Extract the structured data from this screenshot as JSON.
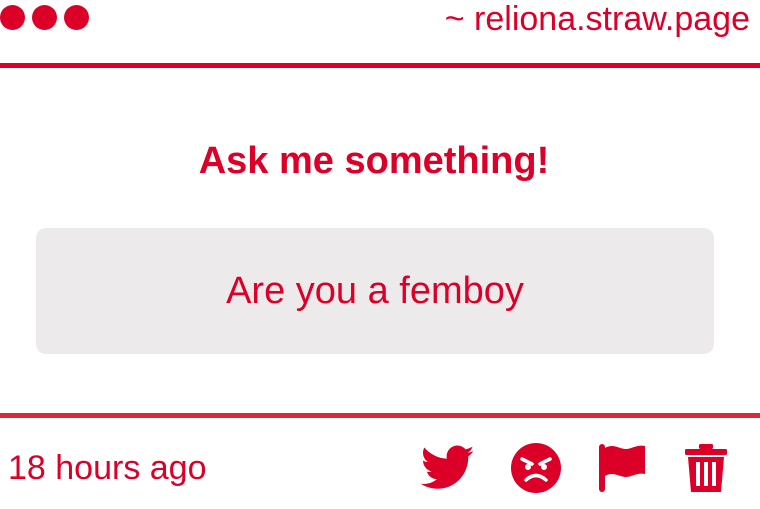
{
  "window": {
    "domain": "~ reliona.straw.page",
    "dots": [
      "dot-1",
      "dot-2",
      "dot-3"
    ]
  },
  "main": {
    "heading": "Ask me something!",
    "question": "Are you a femboy"
  },
  "footer": {
    "timestamp": "18 hours ago",
    "actions": [
      {
        "name": "twitter-share",
        "icon": "twitter-bird-icon"
      },
      {
        "name": "angry-reaction",
        "icon": "angry-face-icon"
      },
      {
        "name": "report",
        "icon": "flag-icon"
      },
      {
        "name": "delete",
        "icon": "trash-icon"
      }
    ]
  },
  "colors": {
    "accent": "#dc0029",
    "question_bg": "#eceaeb",
    "background": "#ffffff"
  }
}
